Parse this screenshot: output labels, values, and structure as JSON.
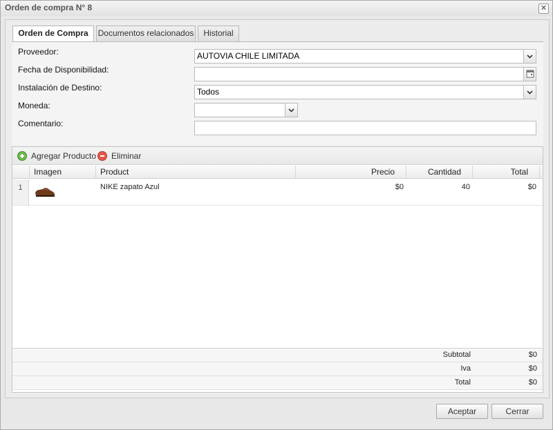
{
  "window": {
    "title": "Orden de compra N° 8",
    "close_glyph": "✕"
  },
  "tabs": [
    {
      "label": "Orden de Compra",
      "active": true
    },
    {
      "label": "Documentos relacionados",
      "active": false
    },
    {
      "label": "Historial",
      "active": false
    }
  ],
  "form": {
    "proveedor": {
      "label": "Proveedor:",
      "value": "AUTOVIA CHILE LIMITADA"
    },
    "fecha": {
      "label": "Fecha de Disponibilidad:",
      "value": ""
    },
    "instalacion": {
      "label": "Instalación de Destino:",
      "value": "Todos"
    },
    "moneda": {
      "label": "Moneda:",
      "value": ""
    },
    "comentario": {
      "label": "Comentario:",
      "value": ""
    }
  },
  "toolbar": {
    "add_label": "Agregar Producto",
    "delete_label": "Eliminar"
  },
  "grid": {
    "columns": [
      "Imagen",
      "Product",
      "Precio",
      "Cantidad",
      "Total"
    ],
    "rows": [
      {
        "num": "1",
        "product": "NIKE zapato Azul",
        "precio": "$0",
        "cantidad": "40",
        "total": "$0"
      }
    ]
  },
  "summary": [
    {
      "label": "Subtotal",
      "value": "$0"
    },
    {
      "label": "Iva",
      "value": "$0"
    },
    {
      "label": "Total",
      "value": "$0"
    }
  ],
  "buttons": {
    "accept": "Aceptar",
    "close": "Cerrar"
  }
}
